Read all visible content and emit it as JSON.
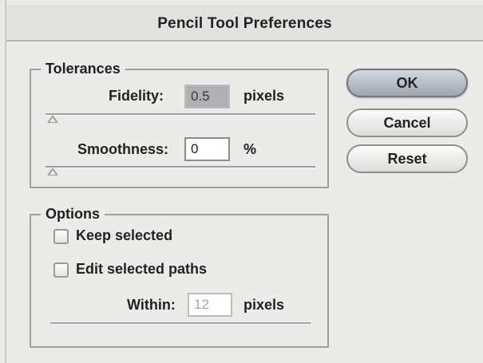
{
  "dialog": {
    "title": "Pencil Tool Preferences"
  },
  "tolerances": {
    "legend": "Tolerances",
    "fidelity": {
      "label": "Fidelity:",
      "value": "0.5",
      "unit": "pixels",
      "slider_value": 0.5
    },
    "smoothness": {
      "label": "Smoothness:",
      "value": "0",
      "unit": "%",
      "slider_value": 0
    }
  },
  "options": {
    "legend": "Options",
    "keep_selected": {
      "label": "Keep selected",
      "checked": false
    },
    "edit_selected_paths": {
      "label": "Edit selected paths",
      "checked": false
    },
    "within": {
      "label": "Within:",
      "value": "12",
      "unit": "pixels"
    }
  },
  "buttons": {
    "ok": "OK",
    "cancel": "Cancel",
    "reset": "Reset"
  }
}
